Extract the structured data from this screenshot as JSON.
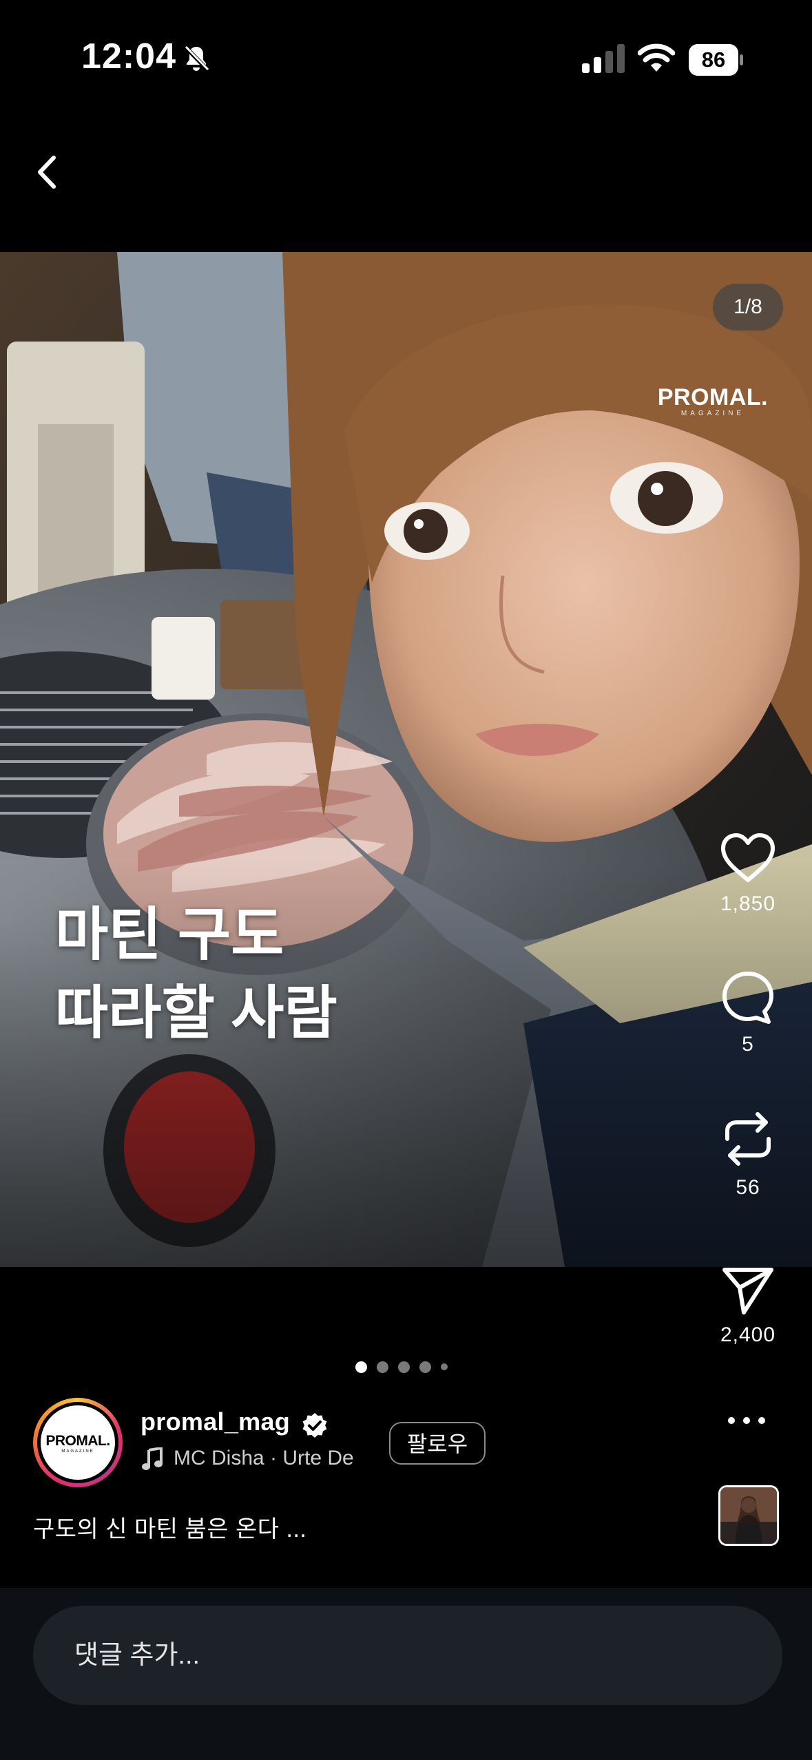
{
  "status_bar": {
    "time": "12:04",
    "battery": "86",
    "icons": [
      "bell-slash-icon",
      "cellular-signal-icon",
      "wifi-icon",
      "battery-icon"
    ]
  },
  "nav": {
    "back_icon": "chevron-left-icon"
  },
  "post": {
    "image_counter": "1/8",
    "watermark": {
      "brand": "PROMAL.",
      "sub": "MAGAZINE"
    },
    "overlay_text": [
      "마틴 구도",
      "따라할 사람"
    ],
    "carousel": {
      "count": 5,
      "active_index": 0
    }
  },
  "actions": {
    "like": {
      "icon": "heart-icon",
      "count": "1,850"
    },
    "comment": {
      "icon": "comment-bubble-icon",
      "count": "5"
    },
    "repost": {
      "icon": "repost-icon",
      "count": "56"
    },
    "share": {
      "icon": "send-icon",
      "count": "2,400"
    },
    "more_icon": "more-horizontal-icon"
  },
  "author": {
    "avatar_text": "PROMAL.",
    "avatar_sub": "MAGAZINE",
    "username": "promal_mag",
    "verified": true,
    "music": "MC Disha · Urte De",
    "follow_label": "팔로우"
  },
  "caption": "구도의 신 마틴 붐은 온다 ...",
  "comment": {
    "placeholder": "댓글 추가..."
  },
  "colors": {
    "background": "#000000",
    "comment_bar": "#0d1116",
    "input": "#1d2229",
    "verified": "#ffffff"
  }
}
